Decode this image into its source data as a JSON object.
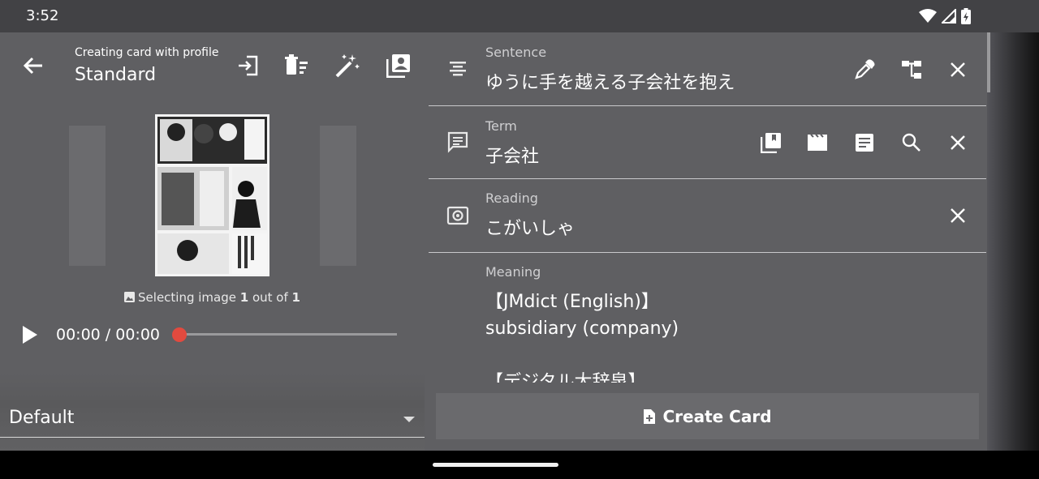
{
  "status_bar": {
    "time": "3:52"
  },
  "header": {
    "subtitle": "Creating card with profile",
    "profile_name": "Standard"
  },
  "image_selector": {
    "caption_prefix": "Selecting image ",
    "current": "1",
    "caption_middle": " out of ",
    "total": "1"
  },
  "audio": {
    "time_display": "00:00 / 00:00",
    "progress": 0
  },
  "profile_dropdown": {
    "selected": "Default"
  },
  "fields": {
    "sentence": {
      "label": "Sentence",
      "value": "ゆうに手を越える子会社を抱え"
    },
    "term": {
      "label": "Term",
      "value": "子会社"
    },
    "reading": {
      "label": "Reading",
      "value": "こがいしゃ"
    },
    "meaning": {
      "label": "Meaning",
      "value": "【JMdict (English)】\nsubsidiary (company)\n\n【デジタル大辞泉】"
    }
  },
  "create_button": {
    "label": "Create Card"
  },
  "colors": {
    "accent_knob": "#e24a3f",
    "background": "#5f5f62"
  }
}
